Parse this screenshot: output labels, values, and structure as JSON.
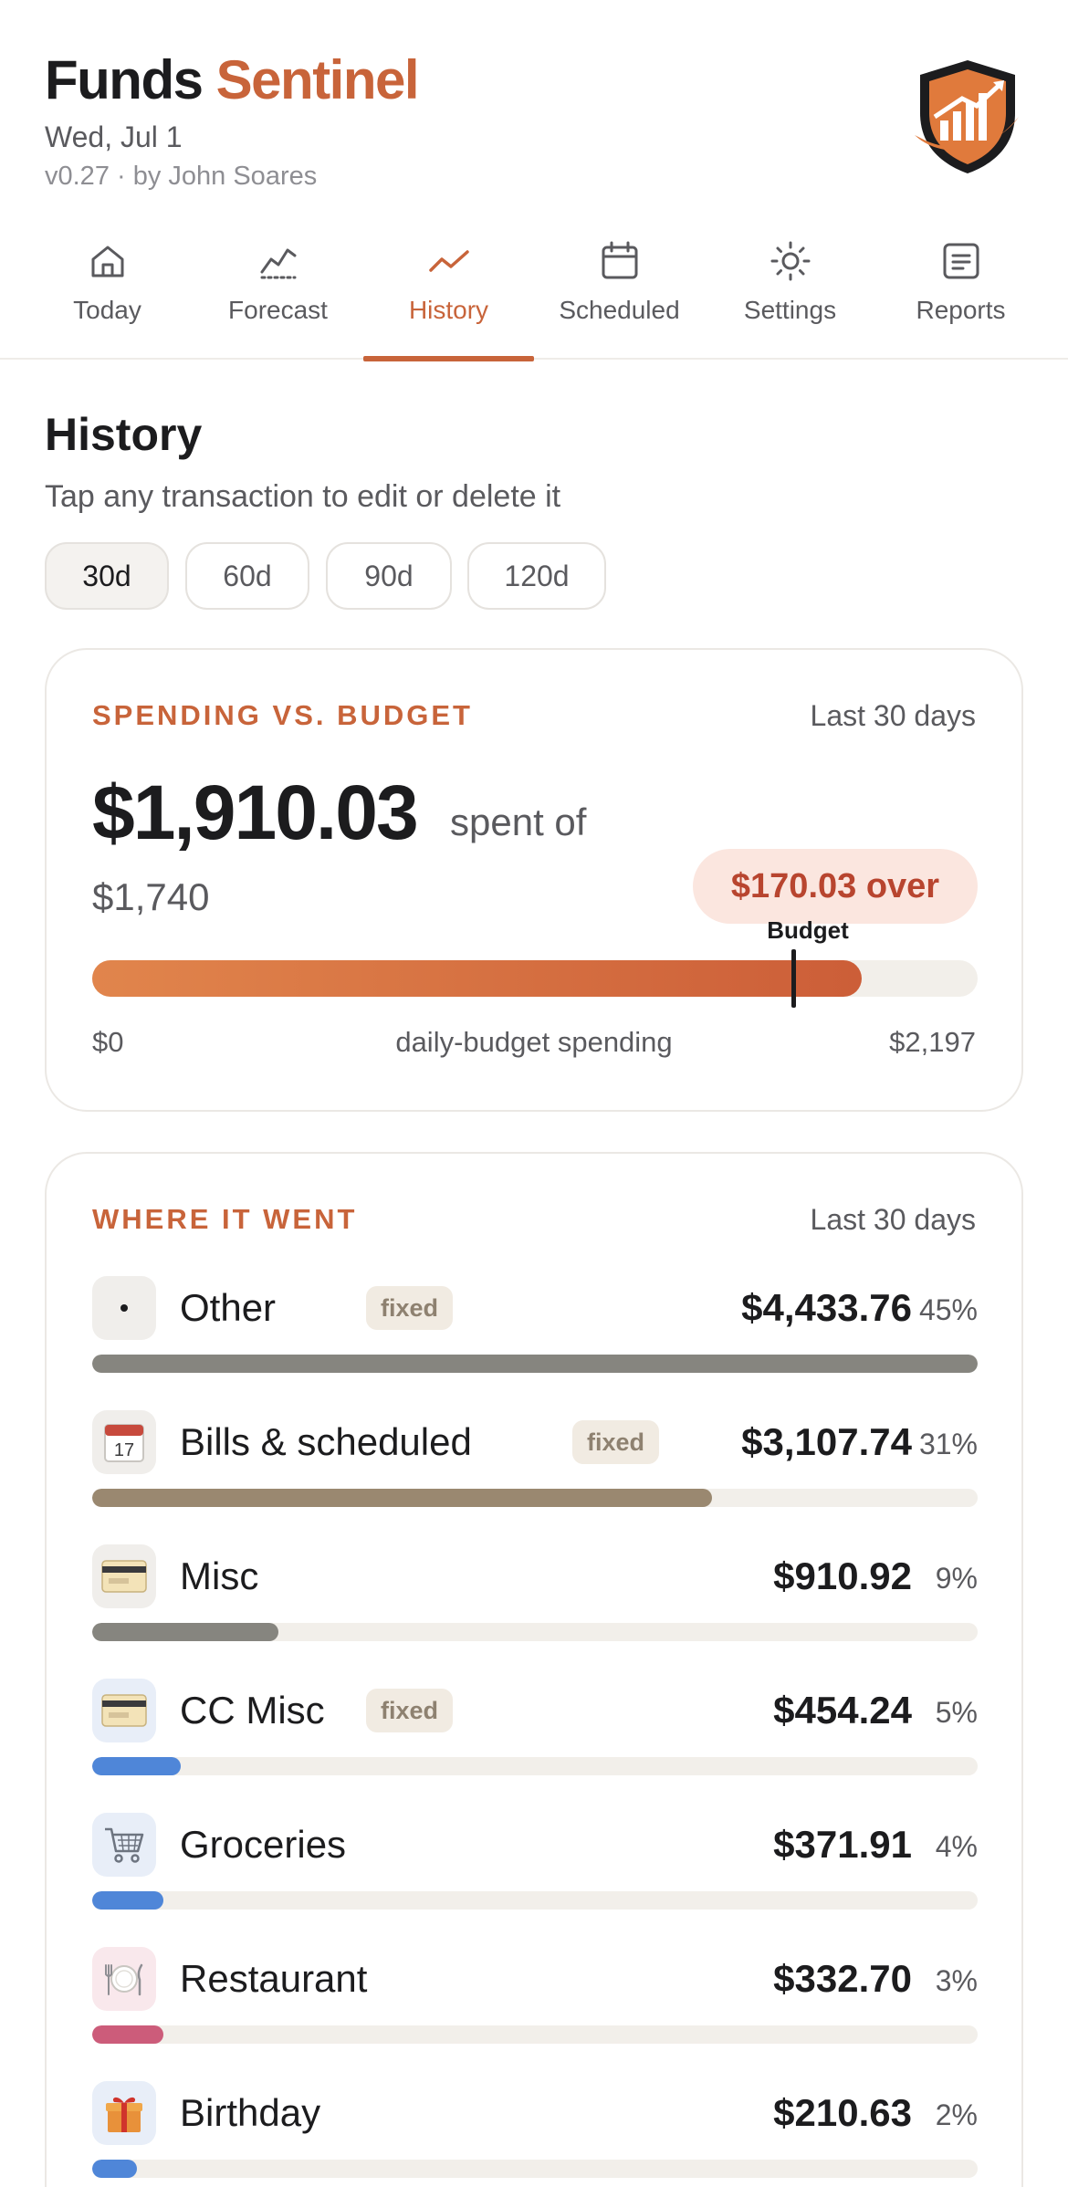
{
  "header": {
    "title_part1": "Funds",
    "title_part2": "Sentinel",
    "date": "Wed, Jul 1",
    "version": "v0.27 · by John Soares"
  },
  "tabs": [
    {
      "label": "Today",
      "icon": "home-icon"
    },
    {
      "label": "Forecast",
      "icon": "forecast-chart-icon"
    },
    {
      "label": "History",
      "icon": "trend-line-icon",
      "active": true
    },
    {
      "label": "Scheduled",
      "icon": "calendar-icon"
    },
    {
      "label": "Settings",
      "icon": "gear-icon"
    },
    {
      "label": "Reports",
      "icon": "document-icon"
    }
  ],
  "history": {
    "title": "History",
    "subtitle": "Tap any transaction to edit or delete it",
    "ranges": [
      "30d",
      "60d",
      "90d",
      "120d"
    ],
    "selected_range": "30d"
  },
  "spending_card": {
    "title": "SPENDING VS. BUDGET",
    "range_label": "Last 30 days",
    "spent": "$1,910.03",
    "spent_of": "spent of",
    "budget": "$1,740",
    "over_badge": "$170.03 over",
    "marker_label": "Budget",
    "scale_min": "$0",
    "scale_mid": "daily-budget spending",
    "scale_max": "$2,197",
    "spent_value": 1910.03,
    "budget_value": 1740,
    "scale_max_value": 2197
  },
  "where_card": {
    "title": "WHERE IT WENT",
    "range_label": "Last 30 days",
    "fixed_label": "fixed",
    "categories": [
      {
        "name": "Other",
        "fixed": true,
        "amount": "$4,433.76",
        "pct": "45%",
        "share": 1.0,
        "color": "#86857f",
        "icon": "dot-icon",
        "icon_bg": "#f0eeeb"
      },
      {
        "name": "Bills & scheduled",
        "fixed": true,
        "amount": "$3,107.74",
        "pct": "31%",
        "share": 0.7,
        "color": "#9a8870",
        "icon": "calendar-page-icon",
        "icon_bg": "#f0eeeb"
      },
      {
        "name": "Misc",
        "fixed": false,
        "amount": "$910.92",
        "pct": "9%",
        "share": 0.21,
        "color": "#86857f",
        "icon": "credit-card-icon",
        "icon_bg": "#f0eeeb"
      },
      {
        "name": "CC Misc",
        "fixed": true,
        "amount": "$454.24",
        "pct": "5%",
        "share": 0.1,
        "color": "#4f86d8",
        "icon": "credit-card-icon",
        "icon_bg": "#e8eef8"
      },
      {
        "name": "Groceries",
        "fixed": false,
        "amount": "$371.91",
        "pct": "4%",
        "share": 0.08,
        "color": "#4f86d8",
        "icon": "shopping-cart-icon",
        "icon_bg": "#e8eef8"
      },
      {
        "name": "Restaurant",
        "fixed": false,
        "amount": "$332.70",
        "pct": "3%",
        "share": 0.08,
        "color": "#cc5c7a",
        "icon": "plate-cutlery-icon",
        "icon_bg": "#f9e8ec"
      },
      {
        "name": "Birthday",
        "fixed": false,
        "amount": "$210.63",
        "pct": "2%",
        "share": 0.05,
        "color": "#4f86d8",
        "icon": "gift-icon",
        "icon_bg": "#e8eef8"
      }
    ]
  }
}
